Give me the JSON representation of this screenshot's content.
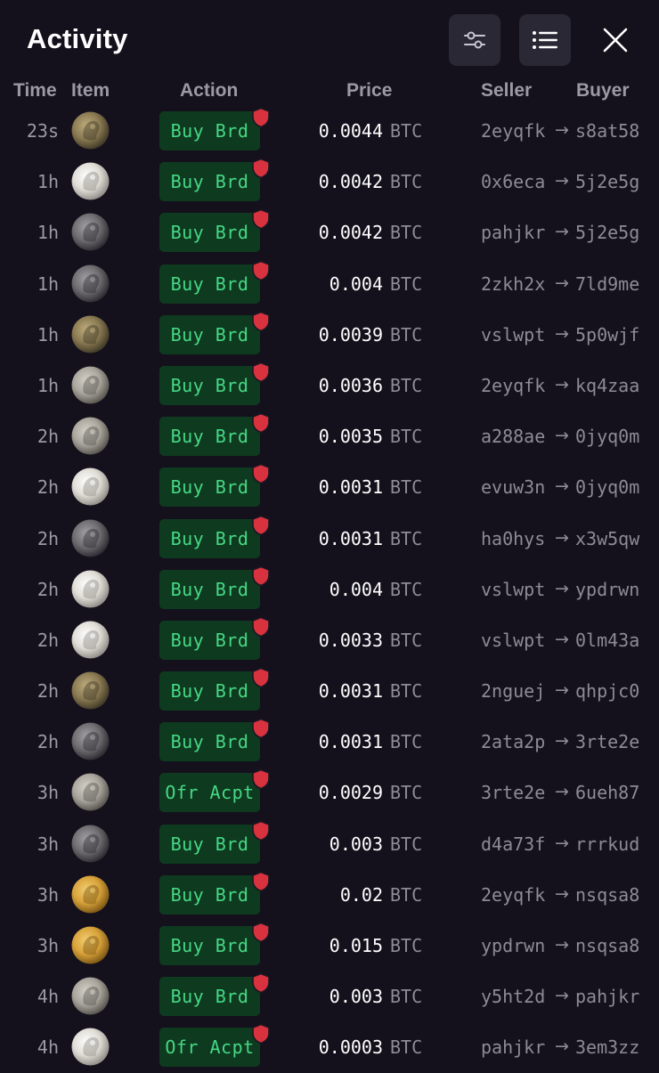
{
  "header": {
    "title": "Activity",
    "filter_icon": "sliders-icon",
    "list_icon": "list-icon",
    "close_icon": "close-icon"
  },
  "columns": {
    "time": "Time",
    "item": "Item",
    "action": "Action",
    "price": "Price",
    "seller": "Seller",
    "buyer": "Buyer"
  },
  "colors": {
    "background": "#14111c",
    "action_bg": "#0e3a1f",
    "action_text": "#46d884",
    "shield": "#d8323f",
    "muted": "#8e8a98"
  },
  "rows": [
    {
      "time": "23s",
      "coin": "bronze",
      "action": "Buy Brd",
      "price": "0.0044",
      "unit": "BTC",
      "seller": "2eyqfk",
      "arrow": "→",
      "buyer": "s8at58"
    },
    {
      "time": "1h",
      "coin": "silver",
      "action": "Buy Brd",
      "price": "0.0042",
      "unit": "BTC",
      "seller": "0x6eca",
      "arrow": "→",
      "buyer": "5j2e5g"
    },
    {
      "time": "1h",
      "coin": "dark",
      "action": "Buy Brd",
      "price": "0.0042",
      "unit": "BTC",
      "seller": "pahjkr",
      "arrow": "→",
      "buyer": "5j2e5g"
    },
    {
      "time": "1h",
      "coin": "dark",
      "action": "Buy Brd",
      "price": "0.004",
      "unit": "BTC",
      "seller": "2zkh2x",
      "arrow": "→",
      "buyer": "7ld9me"
    },
    {
      "time": "1h",
      "coin": "bronze",
      "action": "Buy Brd",
      "price": "0.0039",
      "unit": "BTC",
      "seller": "vslwpt",
      "arrow": "→",
      "buyer": "5p0wjf"
    },
    {
      "time": "1h",
      "coin": "grey",
      "action": "Buy Brd",
      "price": "0.0036",
      "unit": "BTC",
      "seller": "2eyqfk",
      "arrow": "→",
      "buyer": "kq4zaa"
    },
    {
      "time": "2h",
      "coin": "grey",
      "action": "Buy Brd",
      "price": "0.0035",
      "unit": "BTC",
      "seller": "a288ae",
      "arrow": "→",
      "buyer": "0jyq0m"
    },
    {
      "time": "2h",
      "coin": "silver",
      "action": "Buy Brd",
      "price": "0.0031",
      "unit": "BTC",
      "seller": "evuw3n",
      "arrow": "→",
      "buyer": "0jyq0m"
    },
    {
      "time": "2h",
      "coin": "dark",
      "action": "Buy Brd",
      "price": "0.0031",
      "unit": "BTC",
      "seller": "ha0hys",
      "arrow": "→",
      "buyer": "x3w5qw"
    },
    {
      "time": "2h",
      "coin": "silver",
      "action": "Buy Brd",
      "price": "0.004",
      "unit": "BTC",
      "seller": "vslwpt",
      "arrow": "→",
      "buyer": "ypdrwn"
    },
    {
      "time": "2h",
      "coin": "silver",
      "action": "Buy Brd",
      "price": "0.0033",
      "unit": "BTC",
      "seller": "vslwpt",
      "arrow": "→",
      "buyer": "0lm43a"
    },
    {
      "time": "2h",
      "coin": "bronze",
      "action": "Buy Brd",
      "price": "0.0031",
      "unit": "BTC",
      "seller": "2nguej",
      "arrow": "→",
      "buyer": "qhpjc0"
    },
    {
      "time": "2h",
      "coin": "dark",
      "action": "Buy Brd",
      "price": "0.0031",
      "unit": "BTC",
      "seller": "2ata2p",
      "arrow": "→",
      "buyer": "3rte2e"
    },
    {
      "time": "3h",
      "coin": "grey",
      "action": "Ofr Acpt",
      "price": "0.0029",
      "unit": "BTC",
      "seller": "3rte2e",
      "arrow": "→",
      "buyer": "6ueh87"
    },
    {
      "time": "3h",
      "coin": "dark",
      "action": "Buy Brd",
      "price": "0.003",
      "unit": "BTC",
      "seller": "d4a73f",
      "arrow": "→",
      "buyer": "rrrkud"
    },
    {
      "time": "3h",
      "coin": "gold",
      "action": "Buy Brd",
      "price": "0.02",
      "unit": "BTC",
      "seller": "2eyqfk",
      "arrow": "→",
      "buyer": "nsqsa8"
    },
    {
      "time": "3h",
      "coin": "gold",
      "action": "Buy Brd",
      "price": "0.015",
      "unit": "BTC",
      "seller": "ypdrwn",
      "arrow": "→",
      "buyer": "nsqsa8"
    },
    {
      "time": "4h",
      "coin": "grey",
      "action": "Buy Brd",
      "price": "0.003",
      "unit": "BTC",
      "seller": "y5ht2d",
      "arrow": "→",
      "buyer": "pahjkr"
    },
    {
      "time": "4h",
      "coin": "silver",
      "action": "Ofr Acpt",
      "price": "0.0003",
      "unit": "BTC",
      "seller": "pahjkr",
      "arrow": "→",
      "buyer": "3em3zz"
    }
  ]
}
